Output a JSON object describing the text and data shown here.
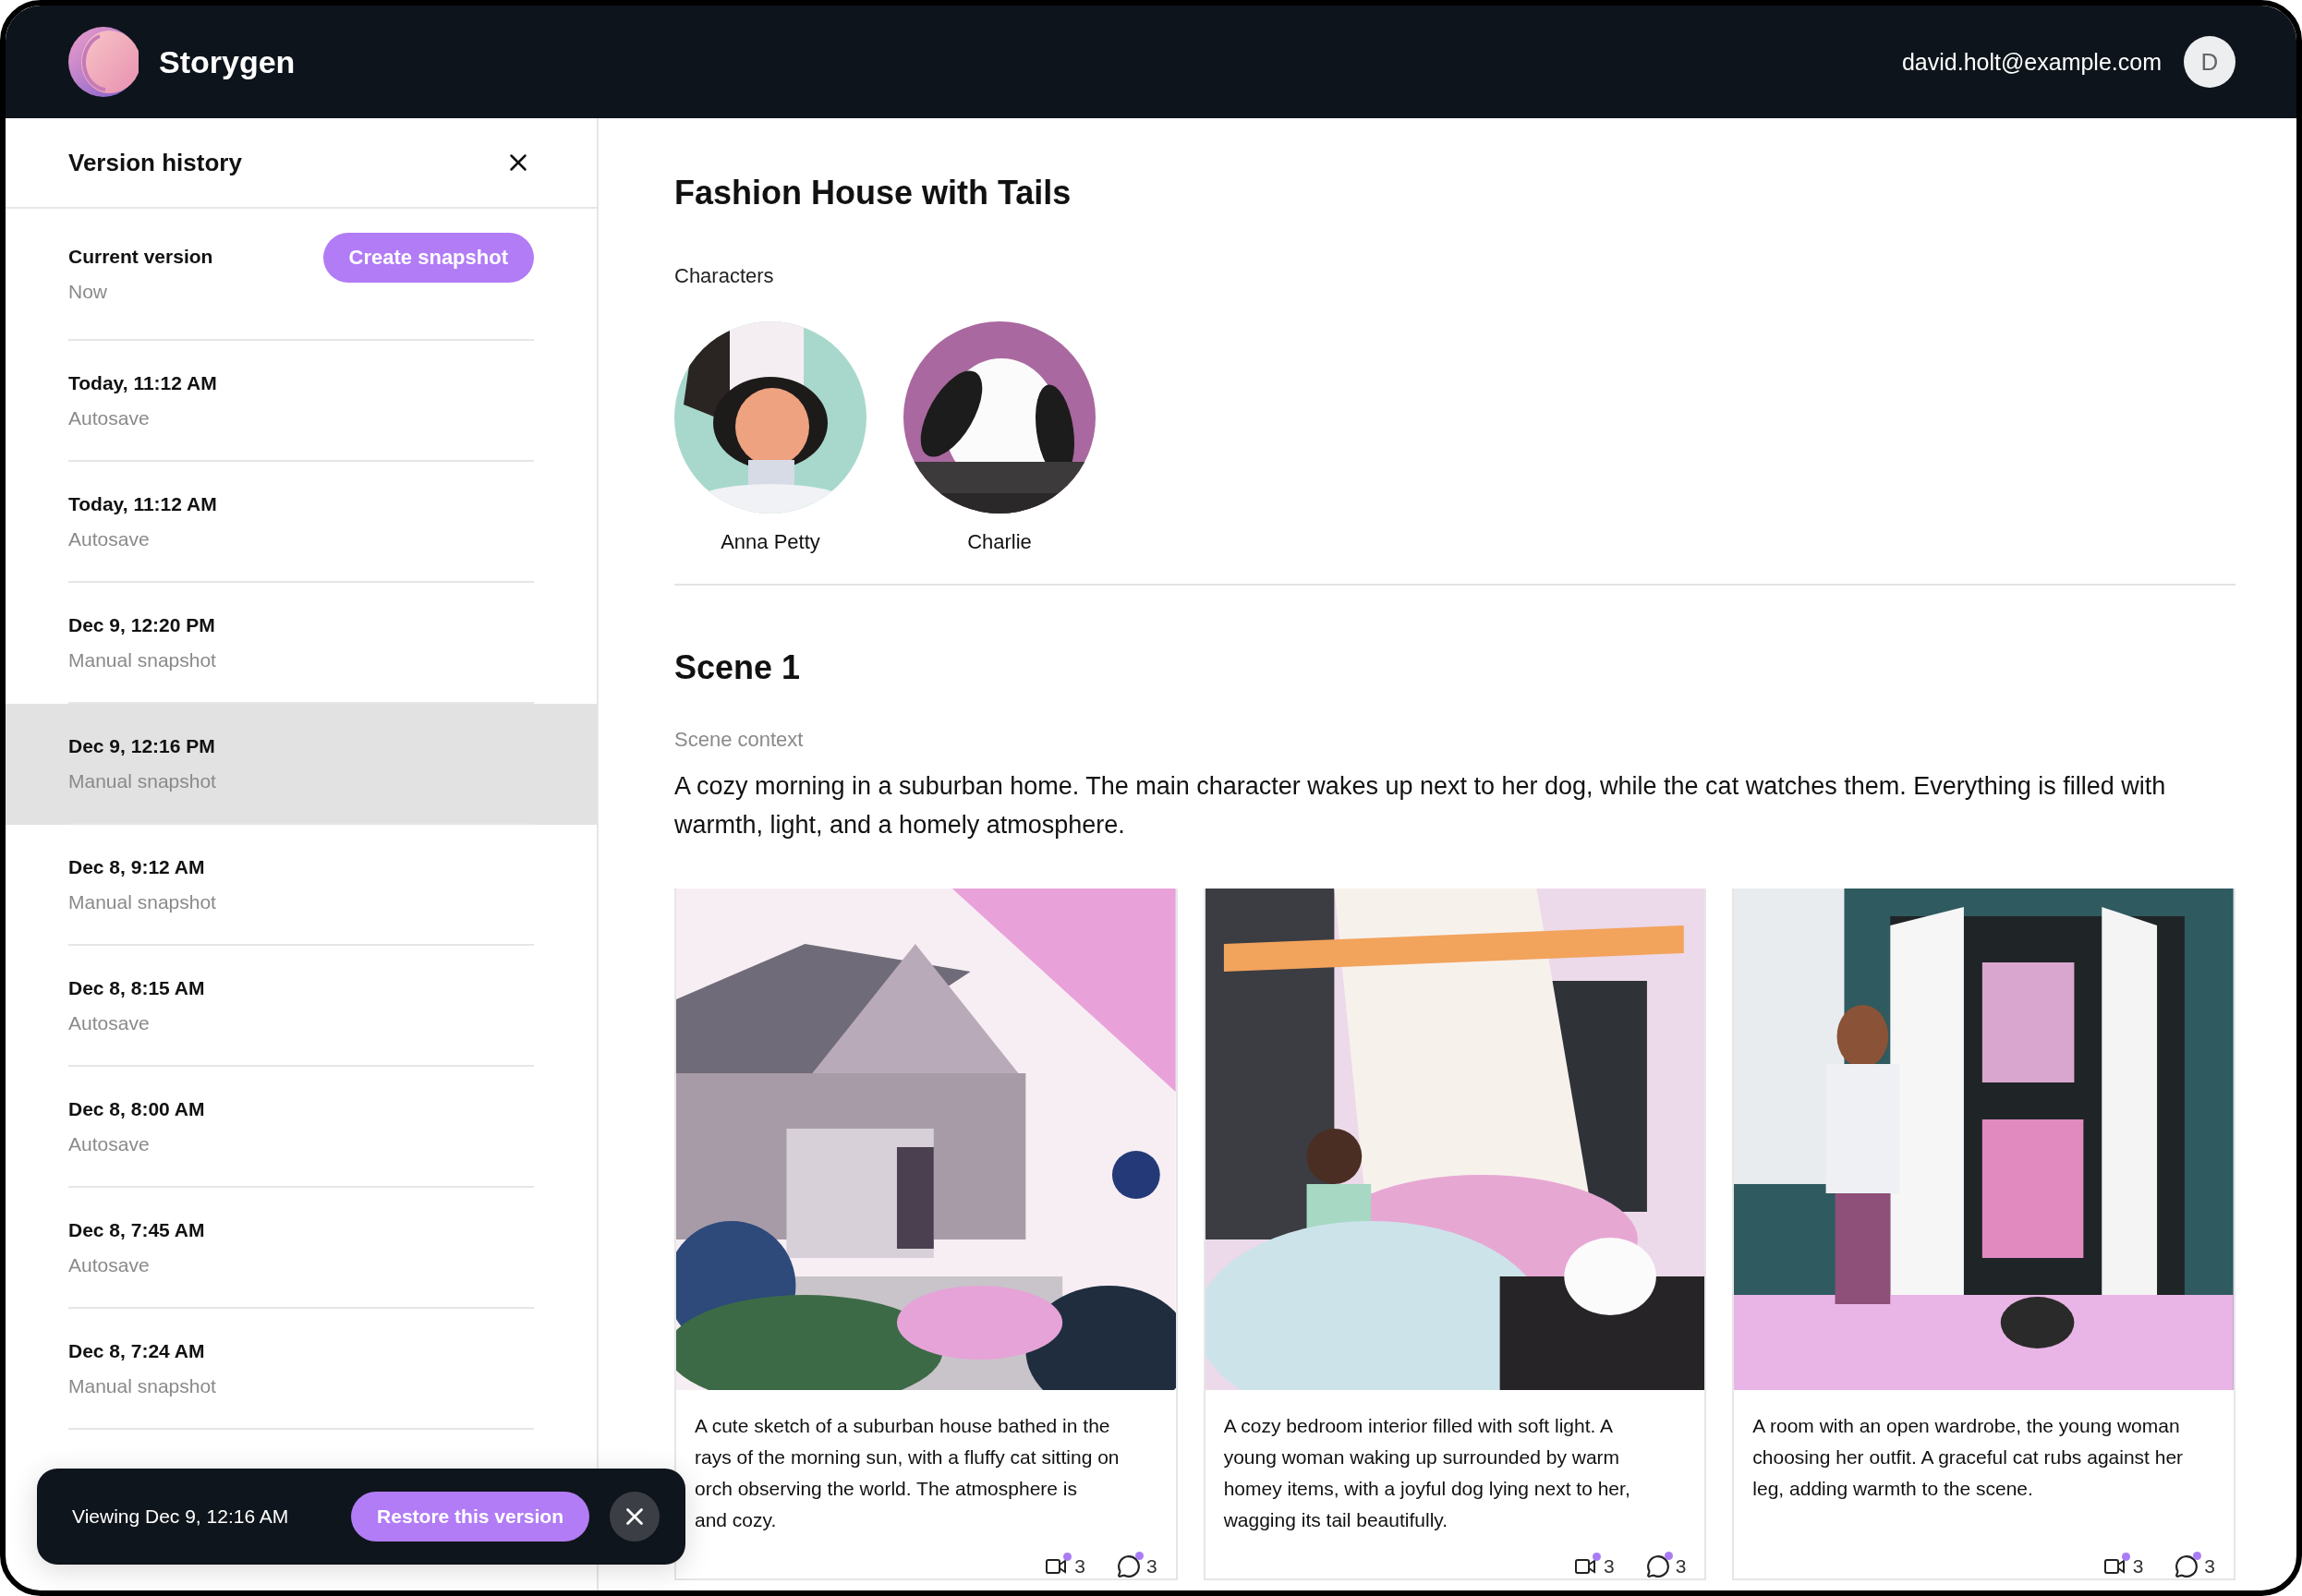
{
  "app": {
    "name": "Storygen"
  },
  "user": {
    "email": "david.holt@example.com",
    "initial": "D"
  },
  "version_history": {
    "title": "Version history",
    "current": {
      "label": "Current version",
      "time": "Now",
      "button": "Create snapshot"
    },
    "versions": [
      {
        "date": "Today, 11:12 AM",
        "type": "Autosave",
        "selected": false
      },
      {
        "date": "Today, 11:12 AM",
        "type": "Autosave",
        "selected": false
      },
      {
        "date": "Dec 9, 12:20 PM",
        "type": "Manual snapshot",
        "selected": false
      },
      {
        "date": "Dec 9, 12:16 PM",
        "type": "Manual snapshot",
        "selected": true
      },
      {
        "date": "Dec 8, 9:12 AM",
        "type": "Manual snapshot",
        "selected": false
      },
      {
        "date": "Dec 8, 8:15 AM",
        "type": "Autosave",
        "selected": false
      },
      {
        "date": "Dec 8, 8:00 AM",
        "type": "Autosave",
        "selected": false
      },
      {
        "date": "Dec 8, 7:45 AM",
        "type": "Autosave",
        "selected": false
      },
      {
        "date": "Dec 8, 7:24 AM",
        "type": "Manual snapshot",
        "selected": false
      }
    ]
  },
  "story": {
    "title": "Fashion House with Tails",
    "characters_label": "Characters",
    "characters": [
      {
        "name": "Anna Petty"
      },
      {
        "name": "Charlie"
      }
    ],
    "scene": {
      "title": "Scene 1",
      "context_label": "Scene context",
      "context": "A cozy morning in a suburban home. The main character wakes up next to her dog, while the cat watches them. Everything is filled with warmth, light, and a homely atmosphere.",
      "frames": [
        {
          "description_lines": [
            "A cute sketch of a suburban house bathed in the",
            "rays of the morning sun, with a fluffy cat sitting on",
            "orch observing the world. The atmosphere is",
            "and cozy."
          ],
          "clips": "3",
          "comments": "3"
        },
        {
          "description_lines": [
            "A cozy bedroom interior filled with soft light. A",
            "young woman waking up surrounded by warm",
            "homey items, with a joyful dog lying next to her,",
            "wagging its tail beautifully."
          ],
          "clips": "3",
          "comments": "3"
        },
        {
          "description_lines": [
            "A room with an open wardrobe, the young woman",
            "choosing her outfit. A graceful cat rubs against her",
            "leg, adding warmth to the scene."
          ],
          "clips": "3",
          "comments": "3"
        }
      ]
    }
  },
  "toast": {
    "text": "Viewing Dec 9, 12:16 AM",
    "button": "Restore this version"
  }
}
